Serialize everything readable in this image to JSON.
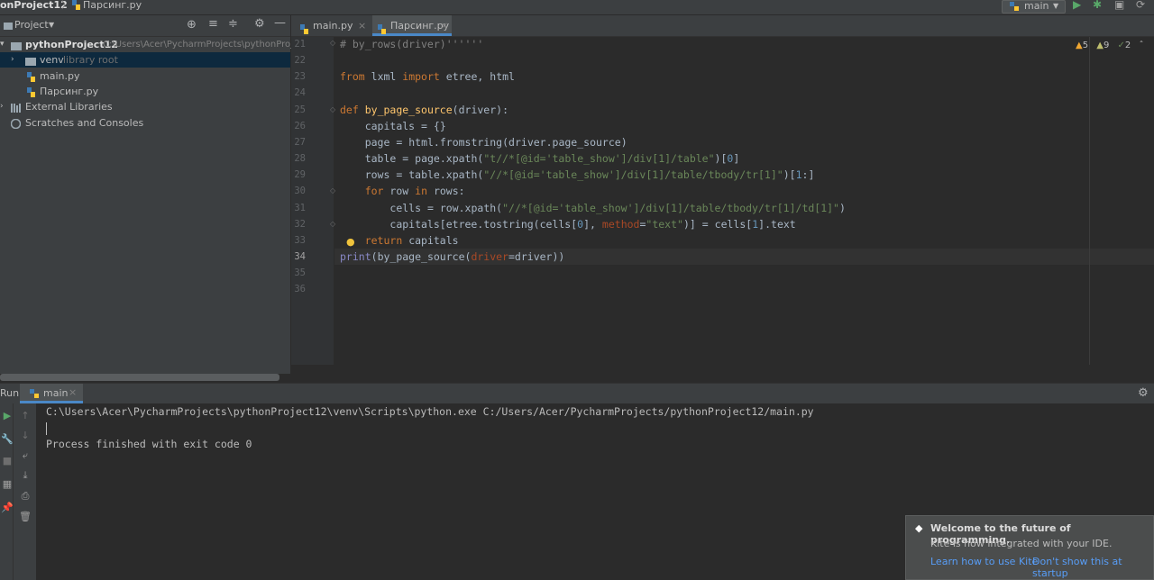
{
  "navbar": {
    "project": "onProject12",
    "file": "Парсинг.py",
    "run_config": "main"
  },
  "project_panel": {
    "title": "Project",
    "tree": [
      {
        "label": "pythonProject12",
        "hint": "C:\\Users\\Acer\\PycharmProjects\\pythonProject"
      },
      {
        "label": "venv",
        "hint": "library root"
      },
      {
        "label": "main.py",
        "hint": ""
      },
      {
        "label": "Парсинг.py",
        "hint": ""
      },
      {
        "label": "External Libraries",
        "hint": ""
      },
      {
        "label": "Scratches and Consoles",
        "hint": ""
      }
    ]
  },
  "editor": {
    "tabs": [
      {
        "label": "main.py",
        "active": false
      },
      {
        "label": "Парсинг.py",
        "active": true
      }
    ],
    "inspections": {
      "warnings": "5",
      "weak_warnings": "9",
      "typos": "2"
    },
    "line_numbers": [
      "21",
      "22",
      "23",
      "24",
      "25",
      "26",
      "27",
      "28",
      "29",
      "30",
      "31",
      "32",
      "33",
      "34",
      "35",
      "36"
    ],
    "current_line": "34",
    "code_lines": [
      "# by_rows(driver)''''''",
      "",
      "from lxml import etree, html",
      "",
      "def by_page_source(driver):",
      "    capitals = {}",
      "    page = html.fromstring(driver.page_source)",
      "    table = page.xpath(\"t//*[@id='table_show']/div[1]/table\")[0]",
      "    rows = table.xpath(\"//*[@id='table_show']/div[1]/table/tbody/tr[1]\")[1:]",
      "    for row in rows:",
      "        cells = row.xpath(\"//*[@id='table_show']/div[1]/table/tbody/tr[1]/td[1]\")",
      "        capitals[etree.tostring(cells[0], method=\"text\")] = cells[1].text",
      "    return capitals",
      "print(by_page_source(driver=driver))",
      "",
      ""
    ]
  },
  "run_panel": {
    "label": "Run:",
    "tab": "main",
    "console": [
      "C:\\Users\\Acer\\PycharmProjects\\pythonProject12\\venv\\Scripts\\python.exe C:/Users/Acer/PycharmProjects/pythonProject12/main.py",
      "",
      "Process finished with exit code 0"
    ]
  },
  "notification": {
    "title": "Welcome to the future of programming.",
    "body": "Kite is now integrated with your IDE.",
    "link1": "Learn how to use Kite",
    "link2": "Don't show this at startup"
  },
  "colors": {
    "background": "#2b2b2b",
    "panel": "#3c3f41",
    "keyword": "#cc7832",
    "function": "#ffc66d",
    "string": "#6a8759",
    "number": "#6897bb",
    "link": "#589df6"
  }
}
